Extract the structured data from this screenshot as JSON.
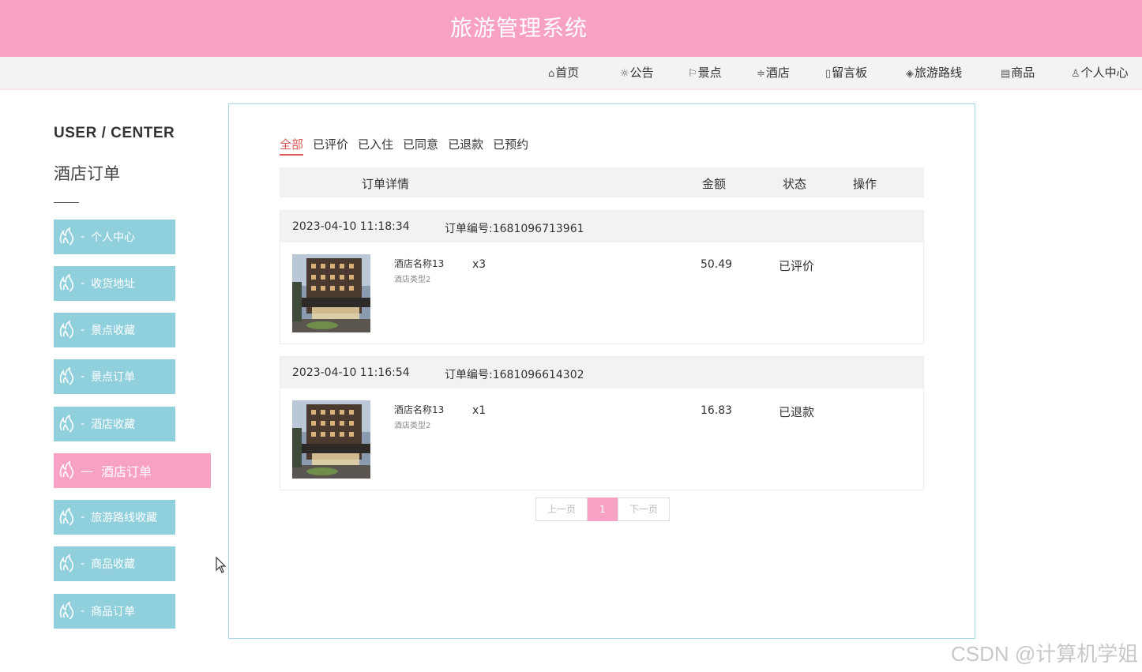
{
  "header": {
    "title": "旅游管理系统"
  },
  "nav": [
    {
      "icon": "home-icon",
      "glyph": "⌂",
      "label": "首页"
    },
    {
      "icon": "gear-icon",
      "glyph": "☼",
      "label": "公告"
    },
    {
      "icon": "flag-icon",
      "glyph": "⚐",
      "label": "景点"
    },
    {
      "icon": "sliders-icon",
      "glyph": "≑",
      "label": "酒店"
    },
    {
      "icon": "message-icon",
      "glyph": "▯",
      "label": "留言板"
    },
    {
      "icon": "layers-icon",
      "glyph": "◈",
      "label": "旅游路线"
    },
    {
      "icon": "clipboard-icon",
      "glyph": "▤",
      "label": "商品"
    },
    {
      "icon": "user-icon",
      "glyph": "♙",
      "label": "个人中心"
    }
  ],
  "sidebar": {
    "title": "USER / CENTER",
    "subtitle": "酒店订单",
    "items": [
      {
        "label": "个人中心"
      },
      {
        "label": "收货地址"
      },
      {
        "label": "景点收藏"
      },
      {
        "label": "景点订单"
      },
      {
        "label": "酒店收藏"
      },
      {
        "label": "酒店订单",
        "active": true
      },
      {
        "label": "旅游路线收藏"
      },
      {
        "label": "商品收藏"
      },
      {
        "label": "商品订单"
      }
    ]
  },
  "tabs": [
    "全部",
    "已评价",
    "已入住",
    "已同意",
    "已退款",
    "已预约"
  ],
  "table": {
    "headers": {
      "detail": "订单详情",
      "amount": "金额",
      "status": "状态",
      "action": "操作"
    }
  },
  "orders": [
    {
      "time": "2023-04-10 11:18:34",
      "order_no": "订单编号:1681096713961",
      "name": "酒店名称13",
      "type": "酒店类型2",
      "qty": "x3",
      "amount": "50.49",
      "status": "已评价"
    },
    {
      "time": "2023-04-10 11:16:54",
      "order_no": "订单编号:1681096614302",
      "name": "酒店名称13",
      "type": "酒店类型2",
      "qty": "x1",
      "amount": "16.83",
      "status": "已退款"
    }
  ],
  "pager": {
    "prev": "上一页",
    "current": "1",
    "next": "下一页"
  },
  "watermark": "CSDN @计算机学姐",
  "colors": {
    "accent": "#f7a1c4",
    "sidebar": "#90cfdc",
    "tab_active": "#e05a5a",
    "panel_border": "#a6d8e8"
  }
}
